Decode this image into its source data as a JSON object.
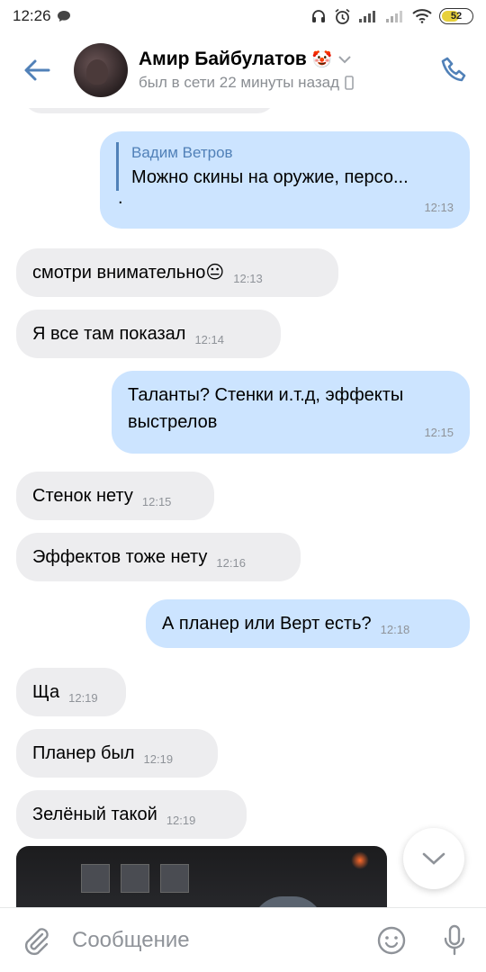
{
  "status_bar": {
    "time": "12:26",
    "battery": "52"
  },
  "header": {
    "contact_name": "Амир Байбулатов",
    "emoji": "🤡",
    "last_seen": "был в сети 22 минуты назад"
  },
  "messages": [
    {
      "id": "m1",
      "direction": "out",
      "reply_author": "Вадим Ветров",
      "reply_text": "Можно скины на оружие, персо...",
      "extra_line": ".",
      "time": "12:13"
    },
    {
      "id": "m2",
      "direction": "in",
      "text": "смотри внимательно😐",
      "time": "12:13"
    },
    {
      "id": "m3",
      "direction": "in",
      "text": "Я все там показал",
      "time": "12:14"
    },
    {
      "id": "m4",
      "direction": "out",
      "text_line1": "Таланты? Стенки и.т.д, эффекты",
      "text_line2": "выстрелов",
      "time": "12:15"
    },
    {
      "id": "m5",
      "direction": "in",
      "text": "Стенок нету",
      "time": "12:15"
    },
    {
      "id": "m6",
      "direction": "in",
      "text": "Эффектов тоже нету",
      "time": "12:16"
    },
    {
      "id": "m7",
      "direction": "out",
      "text": "А планер или Верт есть?",
      "time": "12:18"
    },
    {
      "id": "m8",
      "direction": "in",
      "text": "Ща",
      "time": "12:19"
    },
    {
      "id": "m9",
      "direction": "in",
      "text": "Планер был",
      "time": "12:19"
    },
    {
      "id": "m10",
      "direction": "in",
      "text": "Зелёный такой",
      "time": "12:19"
    }
  ],
  "composer": {
    "placeholder": "Сообщение"
  },
  "colors": {
    "accent": "#5181b8",
    "bubble_in": "#ededef",
    "bubble_out": "#cce4ff",
    "muted": "#8f9399"
  },
  "icons": [
    "back-arrow-icon",
    "chevron-down-icon",
    "phone-icon",
    "chevron-down-icon",
    "paperclip-icon",
    "smile-icon",
    "microphone-icon"
  ]
}
